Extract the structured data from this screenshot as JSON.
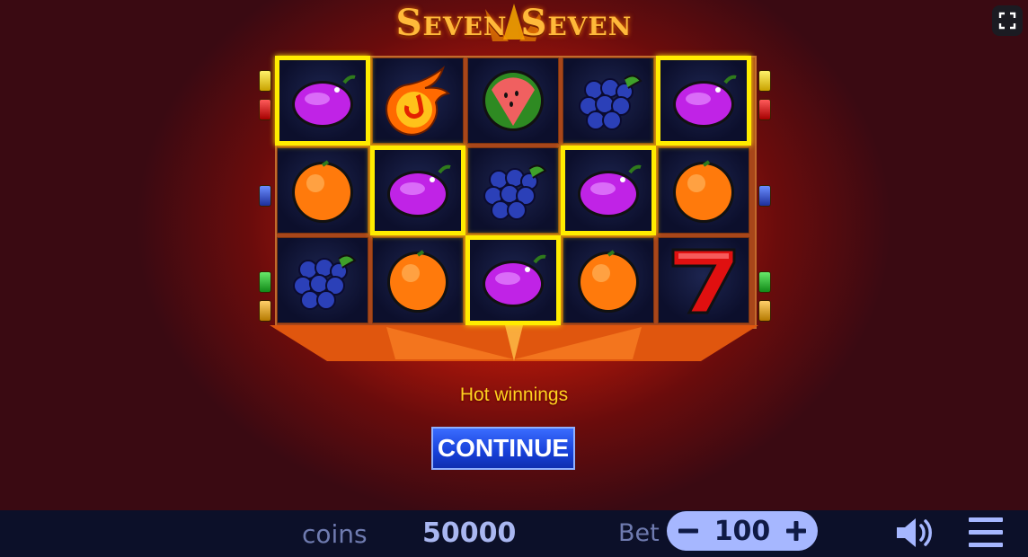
{
  "game": {
    "title": "Seven Seven"
  },
  "reels": {
    "grid": [
      [
        "plum",
        "orange",
        "grapes"
      ],
      [
        "fireball",
        "plum",
        "orange"
      ],
      [
        "watermelon",
        "grapes",
        "plum"
      ],
      [
        "grapes",
        "plum",
        "orange"
      ],
      [
        "plum",
        "orange",
        "seven"
      ]
    ],
    "winning_cells": [
      [
        0,
        0
      ],
      [
        1,
        1
      ],
      [
        2,
        2
      ],
      [
        3,
        1
      ],
      [
        4,
        0
      ]
    ],
    "highlight_color": "#ffec00"
  },
  "message": {
    "text": "Hot winnings"
  },
  "continue_button": {
    "label": "CONTINUE"
  },
  "bottom_bar": {
    "coins_label": "coins",
    "coins_value": "50000",
    "bet_label": "Bet",
    "bet_value": "100",
    "bet_minus_icon": "minus-icon",
    "bet_plus_icon": "plus-icon",
    "sound_icon": "speaker-icon",
    "menu_icon": "hamburger-menu-icon"
  },
  "colors": {
    "background": "#3a0a12",
    "glow": "#d3210c",
    "message": "#ffd21f",
    "button": "#1740d8",
    "bar": "#0c1029"
  }
}
